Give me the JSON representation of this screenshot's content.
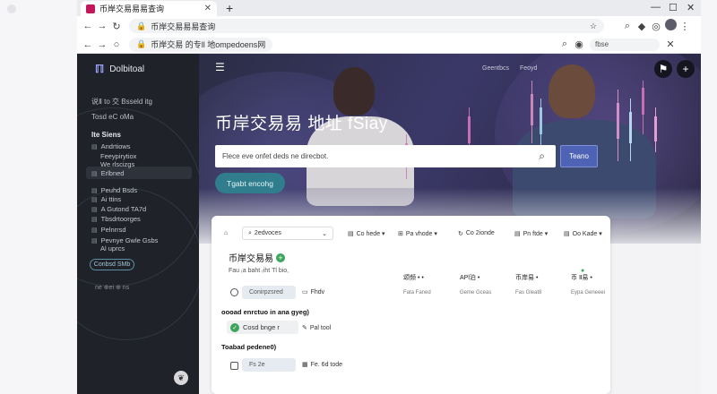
{
  "browser": {
    "tab_title": "币岸交易易易查询",
    "new_tab": "+",
    "controls": [
      "—",
      "☐",
      "✕"
    ],
    "address": "币岸交易易易查询",
    "address2": "币岸交易 的专ll 地ompedoens网",
    "mini_search": "fbse",
    "nav_back": "←",
    "nav_forward": "→",
    "nav_reload": "↻"
  },
  "sidebar": {
    "brand": "Dolbitoal",
    "line1": "说Ⅱ to 交    Bsseld itg",
    "line2": "Tosd eC oMa",
    "section": "Ite Siens",
    "items": [
      {
        "glyph": "▤",
        "label": "Andrtiows"
      },
      {
        "glyph": "",
        "label": "Feeypirytiox"
      },
      {
        "glyph": "",
        "label": "We rlscizgs"
      },
      {
        "glyph": "▤",
        "label": "Erlbned"
      },
      {
        "glyph": "▤",
        "label": "Peuhd Bsds"
      },
      {
        "glyph": "▤",
        "label": "Ai ttins"
      },
      {
        "glyph": "▤",
        "label": "A Gutond TA7d"
      },
      {
        "glyph": "▤",
        "label": "Tbsdrtoorges"
      },
      {
        "glyph": "▤",
        "label": "Pelnrrsd"
      },
      {
        "glyph": "▤",
        "label": "Pevnye Gwle Gsbs"
      },
      {
        "glyph": "",
        "label": "Al uprcs"
      }
    ],
    "contact_button": "Conbsd SMb",
    "footer": "ne ⊕ei ⊕ ns"
  },
  "hero": {
    "menu_icon": "☰",
    "nav": [
      "Geentbcs",
      "Feoyd"
    ],
    "title": "币岸交易易 地址 fSiay",
    "search_placeholder": "Flece eve onfet deds ne direcbot.",
    "search_button": "Teano",
    "pill_button": "Tgabt encohg"
  },
  "card": {
    "filters": [
      {
        "icon": "⌂",
        "label": ""
      },
      {
        "icon": "⌕",
        "label": "2edvoces"
      },
      {
        "icon": "▤",
        "label": "Co hede ▾"
      },
      {
        "icon": "⊞",
        "label": "Pa vhode ▾"
      },
      {
        "icon": "↻",
        "label": "Co 2ionde"
      },
      {
        "icon": "▤",
        "label": "Pn ftde ▾"
      },
      {
        "icon": "▤",
        "label": "Oo Kade ▾"
      }
    ],
    "heading": "币岸交易易",
    "sub": "Fau ₍a baht ₍iht Tl bio,",
    "columns": [
      {
        "head": "颂频 • •",
        "sub": "Fata  Faned"
      },
      {
        "head": "APl泊 •",
        "sub": "Geme  Gceas"
      },
      {
        "head": "币岸易  •",
        "sub": "Fas  Gleat8"
      },
      {
        "head": "币 Ⅱ易 •",
        "sub": "Eypa  Geneeei"
      }
    ],
    "chip1": "Conirpzsred",
    "chip1_side": "Fhdv",
    "label1": "oooad enrctuo in ana gyeg)",
    "check_label": "Cosd bnge r",
    "check_side": "Pal tool",
    "label2": "Toabad pedene0)",
    "chip2": "Fs 2e",
    "chip2_side": "Fe. 6d tode"
  }
}
